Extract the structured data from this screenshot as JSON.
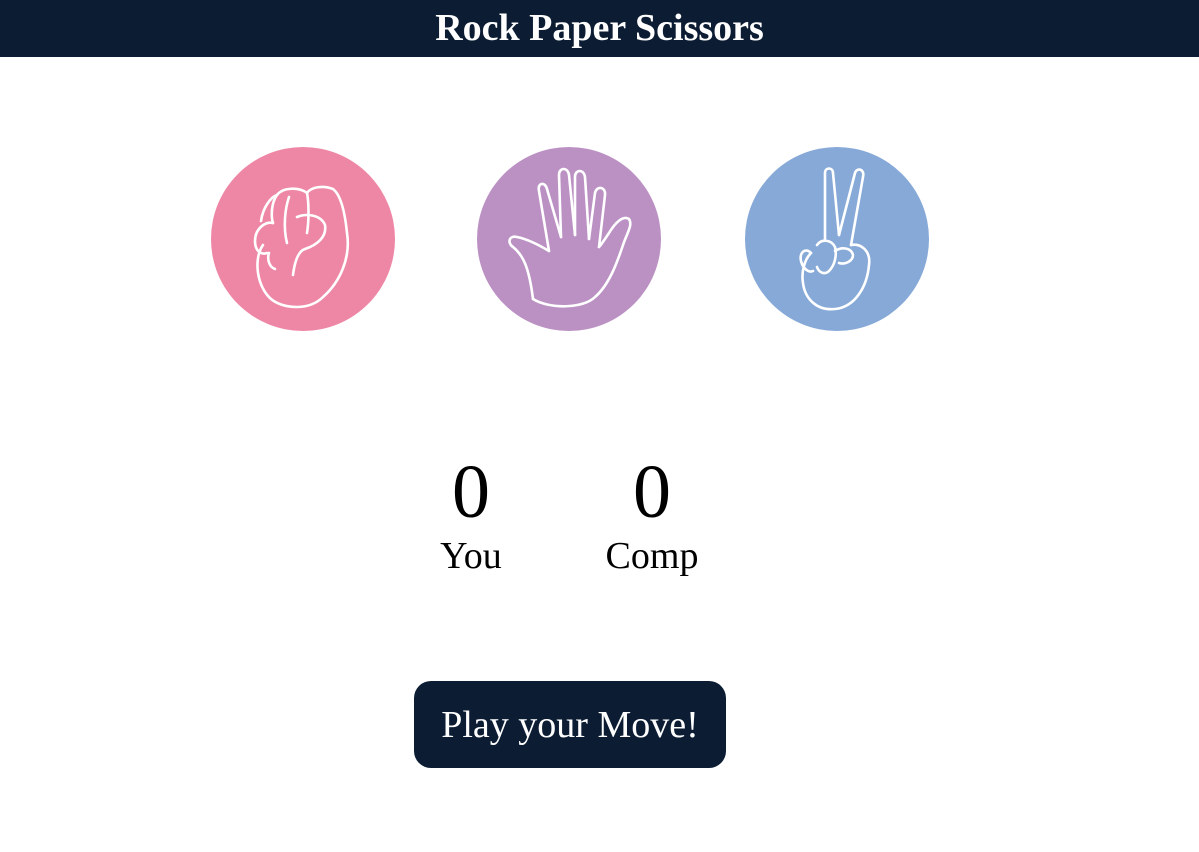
{
  "header": {
    "title": "Rock Paper Scissors",
    "background": "#0b1c33"
  },
  "choices": [
    {
      "id": "rock",
      "icon": "fist-icon",
      "color": "#ee87a5"
    },
    {
      "id": "paper",
      "icon": "open-hand-icon",
      "color": "#bb91c4"
    },
    {
      "id": "scissors",
      "icon": "peace-sign-icon",
      "color": "#87a9d8"
    }
  ],
  "scoreboard": {
    "user": {
      "score": "0",
      "label": "You"
    },
    "comp": {
      "score": "0",
      "label": "Comp"
    }
  },
  "message": {
    "text": "Play your Move!",
    "background": "#0b1c33"
  }
}
